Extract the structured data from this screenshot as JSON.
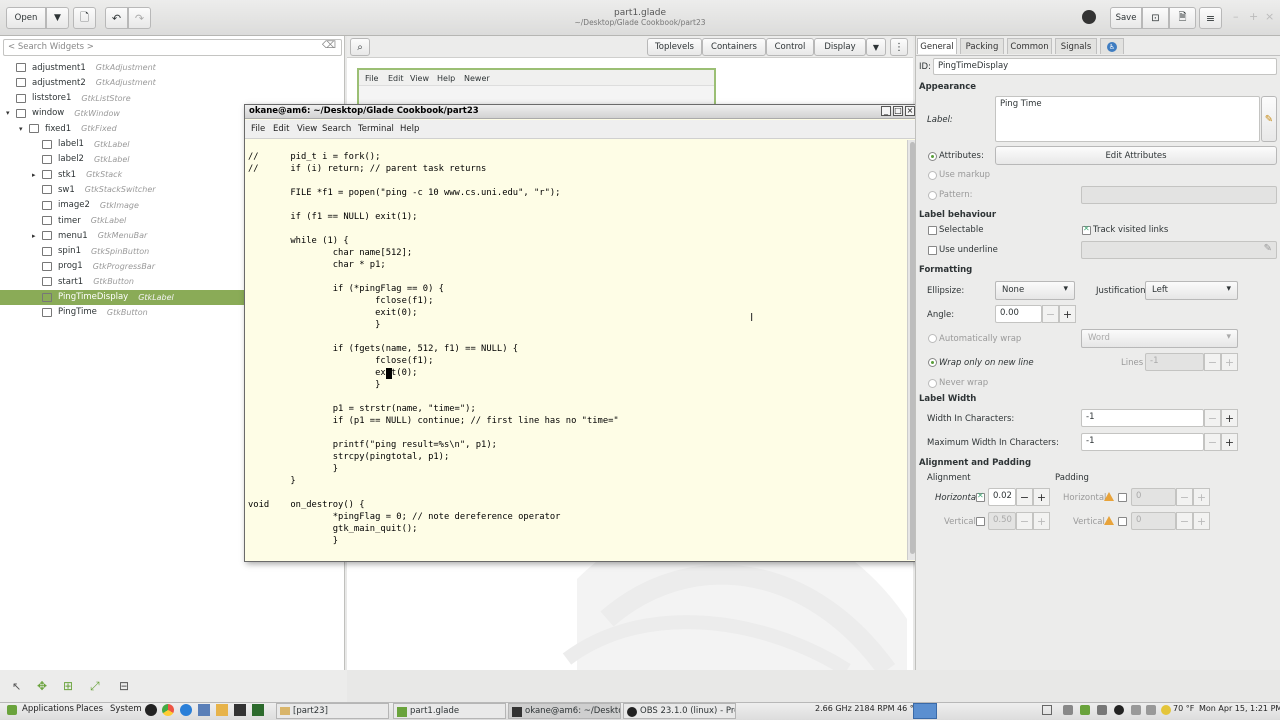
{
  "header": {
    "open_label": "Open",
    "title": "part1.glade",
    "subtitle": "~/Desktop/Glade Cookbook/part23",
    "save_label": "Save"
  },
  "left": {
    "search_placeholder": "< Search Widgets >",
    "tree": [
      {
        "name": "adjustment1",
        "type": "GtkAdjustment",
        "icon": "adjustment-icon",
        "expander": ""
      },
      {
        "name": "adjustment2",
        "type": "GtkAdjustment",
        "icon": "adjustment-icon",
        "expander": ""
      },
      {
        "name": "liststore1",
        "type": "GtkListStore",
        "icon": "liststore-icon",
        "expander": ""
      },
      {
        "name": "window",
        "type": "GtkWindow",
        "icon": "window-icon",
        "expander": "▾"
      },
      {
        "name": "fixed1",
        "type": "GtkFixed",
        "icon": "fixed-icon",
        "expander": "▾"
      },
      {
        "name": "label1",
        "type": "GtkLabel",
        "icon": "label-icon",
        "expander": ""
      },
      {
        "name": "label2",
        "type": "GtkLabel",
        "icon": "label-icon",
        "expander": ""
      },
      {
        "name": "stk1",
        "type": "GtkStack",
        "icon": "stack-icon",
        "expander": "▸"
      },
      {
        "name": "sw1",
        "type": "GtkStackSwitcher",
        "icon": "stackswitcher-icon",
        "expander": ""
      },
      {
        "name": "image2",
        "type": "GtkImage",
        "icon": "image-icon",
        "expander": ""
      },
      {
        "name": "timer",
        "type": "GtkLabel",
        "icon": "label-icon",
        "expander": ""
      },
      {
        "name": "menu1",
        "type": "GtkMenuBar",
        "icon": "menubar-icon",
        "expander": "▸"
      },
      {
        "name": "spin1",
        "type": "GtkSpinButton",
        "icon": "spinbutton-icon",
        "expander": ""
      },
      {
        "name": "prog1",
        "type": "GtkProgressBar",
        "icon": "progressbar-icon",
        "expander": ""
      },
      {
        "name": "start1",
        "type": "GtkButton",
        "icon": "button-icon",
        "expander": ""
      },
      {
        "name": "PingTimeDisplay",
        "type": "GtkLabel",
        "icon": "label-icon",
        "expander": "",
        "selected": true
      },
      {
        "name": "PingTime",
        "type": "GtkButton",
        "icon": "button-icon",
        "expander": ""
      }
    ]
  },
  "center": {
    "toolbar": [
      "Toplevels",
      "Containers",
      "Control",
      "Display"
    ],
    "canvas_menu": [
      "File",
      "Edit",
      "View",
      "Help",
      "Newer"
    ]
  },
  "terminal": {
    "title": "okane@am6: ~/Desktop/Glade Cookbook/part23",
    "menu": [
      "File",
      "Edit",
      "View",
      "Search",
      "Terminal",
      "Help"
    ],
    "lines": [
      "//      pid_t i = fork();",
      "//      if (i) return; // parent task returns",
      "",
      "        FILE *f1 = popen(\"ping -c 10 www.cs.uni.edu\", \"r\");",
      "",
      "        if (f1 == NULL) exit(1);",
      "",
      "        while (1) {",
      "                char name[512];",
      "                char * p1;",
      "",
      "                if (*pingFlag == 0) {",
      "                        fclose(f1);",
      "                        exit(0);",
      "                        }",
      "",
      "                if (fgets(name, 512, f1) == NULL) {",
      "                        fclose(f1);",
      "                        exit(0);",
      "                        }",
      "",
      "                p1 = strstr(name, \"time=\");",
      "                if (p1 == NULL) continue; // first line has no \"time=\"",
      "",
      "                printf(\"ping result=%s\\n\", p1);",
      "                strcpy(pingtotal, p1);",
      "                }",
      "        }",
      "",
      "void    on_destroy() {",
      "                *pingFlag = 0; // note dereference operator",
      "                gtk_main_quit();",
      "                }"
    ]
  },
  "props": {
    "tabs": [
      "General",
      "Packing",
      "Common",
      "Signals"
    ],
    "id_label": "ID:",
    "id_value": "PingTimeDisplay",
    "appearance": "Appearance",
    "label_label": "Label:",
    "label_value": "Ping Time",
    "attributes": "Attributes:",
    "edit_attributes": "Edit Attributes",
    "use_markup": "Use markup",
    "pattern": "Pattern:",
    "label_behaviour": "Label behaviour",
    "selectable": "Selectable",
    "track_visited": "Track visited links",
    "use_underline": "Use underline",
    "formatting": "Formatting",
    "ellipsize": "Ellipsize:",
    "ellipsize_value": "None",
    "justification": "Justification:",
    "justification_value": "Left",
    "angle": "Angle:",
    "angle_value": "0.00",
    "auto_wrap": "Automatically wrap",
    "wrap_mode": "Word",
    "wrap_new_line": "Wrap only on new line",
    "lines": "Lines",
    "lines_value": "-1",
    "never_wrap": "Never wrap",
    "label_width": "Label Width",
    "width_chars": "Width In Characters:",
    "width_chars_value": "-1",
    "max_width_chars": "Maximum Width In Characters:",
    "max_width_chars_value": "-1",
    "align_padding": "Alignment and Padding",
    "alignment": "Alignment",
    "padding": "Padding",
    "horizontal": "Horizontal",
    "vertical": "Vertical",
    "h_align_value": "0.02",
    "v_align_value": "0.50",
    "h_pad_value": "0",
    "v_pad_value": "0"
  },
  "taskbar": {
    "menus": [
      "Applications",
      "Places",
      "System"
    ],
    "tasks": [
      "[part23]",
      "part1.glade",
      "okane@am6: ~/Deskto...",
      "OBS 23.1.0 (linux) - Pro..."
    ],
    "cpu": "2.66 GHz 2184 RPM 46 °C",
    "weather": "70 °F",
    "clock": "Mon Apr 15, 1:21 PM"
  }
}
